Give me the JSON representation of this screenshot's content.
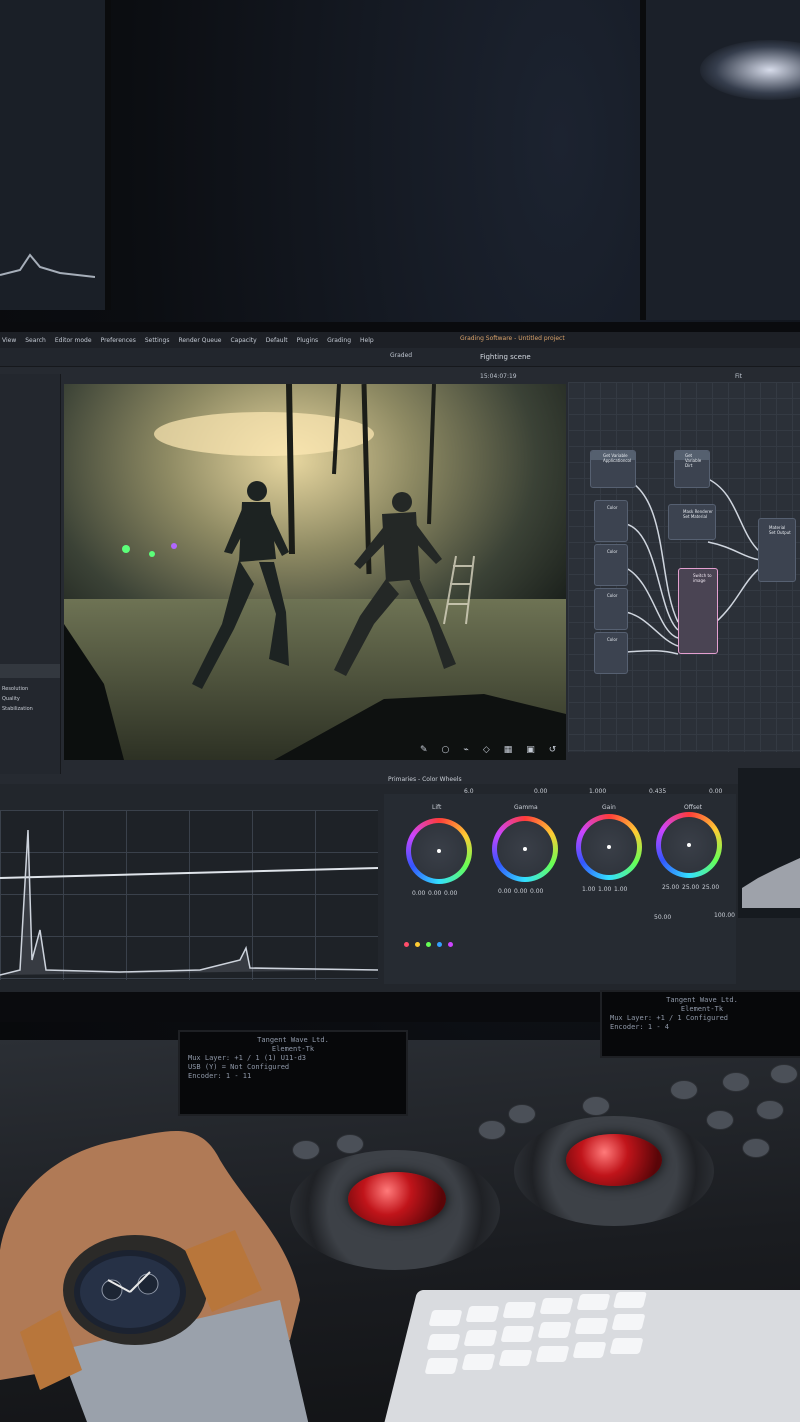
{
  "menubar": {
    "items": [
      "View",
      "Search",
      "Editor mode",
      "Preferences",
      "Settings",
      "Render Queue",
      "Capacity",
      "Default",
      "Plugins",
      "Grading",
      "Help"
    ],
    "project": "Grading Software - Untitled project"
  },
  "viewer": {
    "title": "Fighting scene",
    "timecode": "15:04:07:19",
    "zoom": "Fit",
    "mode": "Graded"
  },
  "left_panel": {
    "items": [
      "Resolution",
      "Quality",
      "Stabilization"
    ]
  },
  "node_graph": {
    "nodes": [
      {
        "label": "Get Variable Applicationcol"
      },
      {
        "label": "Get Variable Dirt"
      },
      {
        "label": "Color"
      },
      {
        "label": "Color"
      },
      {
        "label": "Color"
      },
      {
        "label": "Color"
      },
      {
        "label": "Mask Renderer Set Material"
      },
      {
        "label": "Switch to image"
      },
      {
        "label": "Material Set Output"
      }
    ]
  },
  "color_panel": {
    "title": "Primaries - Color Wheels",
    "temp": "6.0",
    "tint": "0.00",
    "contrast": "1.000",
    "pivot": "0.435",
    "mid_detail": "0.00",
    "wheels": [
      {
        "name": "Lift",
        "values": [
          "0.00",
          "0.00",
          "0.00",
          "0.00"
        ],
        "color": "#ff4d6a"
      },
      {
        "name": "Gamma",
        "values": [
          "0.00",
          "0.00",
          "0.00",
          "0.00"
        ],
        "color": "#9cff66"
      },
      {
        "name": "Gain",
        "values": [
          "1.00",
          "1.00",
          "1.00",
          "1.00"
        ],
        "color": "#66b3ff"
      },
      {
        "name": "Offset",
        "values": [
          "25.00",
          "25.00",
          "25.00"
        ],
        "color": "#ff66cc"
      }
    ],
    "saturation": "50.00",
    "hue": "50.00",
    "lum_mix": "100.00"
  },
  "lcd_left": {
    "lines": [
      "Tangent Wave Ltd.",
      "Element-Tk",
      "Mux Layer: +1 / 1 (1) U11-d3",
      "USB (Y) = Not Configured",
      "Encoder: 1 - 11"
    ]
  },
  "lcd_right": {
    "lines": [
      "Tangent Wave Ltd.",
      "Element-Tk",
      "Mux Layer: +1 / 1 Configured",
      "Encoder: 1 - 4"
    ]
  }
}
